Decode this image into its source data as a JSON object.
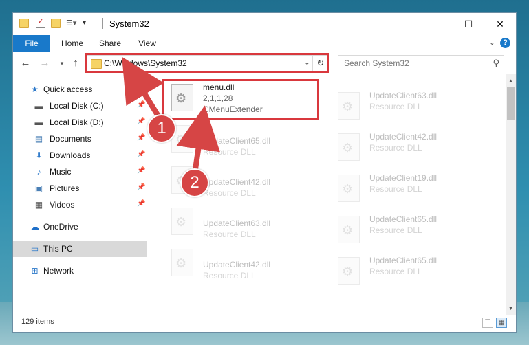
{
  "window": {
    "title": "System32"
  },
  "ribbon": {
    "tabs": [
      {
        "label": "File"
      },
      {
        "label": "Home"
      },
      {
        "label": "Share"
      },
      {
        "label": "View"
      }
    ]
  },
  "titlebar": {
    "minimize": "—",
    "maximize": "☐",
    "close": "✕"
  },
  "address": {
    "path": "C:\\Windows\\System32"
  },
  "search": {
    "placeholder": "Search System32"
  },
  "sidebar": {
    "items": [
      {
        "label": "Quick access",
        "icon": "star-icon"
      },
      {
        "label": "Local Disk (C:)",
        "icon": "drive-icon",
        "pinned": true
      },
      {
        "label": "Local Disk (D:)",
        "icon": "drive-icon",
        "pinned": true
      },
      {
        "label": "Documents",
        "icon": "documents-icon",
        "pinned": true
      },
      {
        "label": "Downloads",
        "icon": "downloads-icon",
        "pinned": true
      },
      {
        "label": "Music",
        "icon": "music-icon",
        "pinned": true
      },
      {
        "label": "Pictures",
        "icon": "pictures-icon",
        "pinned": true
      },
      {
        "label": "Videos",
        "icon": "videos-icon",
        "pinned": true
      },
      {
        "label": "OneDrive",
        "icon": "onedrive-icon"
      },
      {
        "label": "This PC",
        "icon": "this-pc-icon",
        "selected": true
      },
      {
        "label": "Network",
        "icon": "network-icon"
      }
    ]
  },
  "files": {
    "highlighted": {
      "name": "menu.dll",
      "version": "2,1,1,28",
      "description": "CMenuExtender"
    },
    "right_column": [
      {
        "name": "UpdateClient63.dll",
        "type": "Resource DLL"
      },
      {
        "name": "UpdateClient42.dll",
        "type": "Resource DLL"
      },
      {
        "name": "UpdateClient19.dll",
        "type": "Resource DLL"
      },
      {
        "name": "UpdateClient65.dll",
        "type": "Resource DLL"
      },
      {
        "name": "UpdateClient65.dll",
        "type": "Resource DLL"
      }
    ],
    "left_column": [
      {
        "name": "UpdateClient65.dll",
        "type": "Resource DLL"
      },
      {
        "name": "UpdateClient42.dll",
        "type": "Resource DLL"
      },
      {
        "name": "UpdateClient63.dll",
        "type": "Resource DLL"
      },
      {
        "name": "UpdateClient42.dll",
        "type": "Resource DLL"
      }
    ]
  },
  "status": {
    "item_count": "129 items"
  },
  "annotations": {
    "step1": "1",
    "step2": "2",
    "color": "#d9383d"
  }
}
